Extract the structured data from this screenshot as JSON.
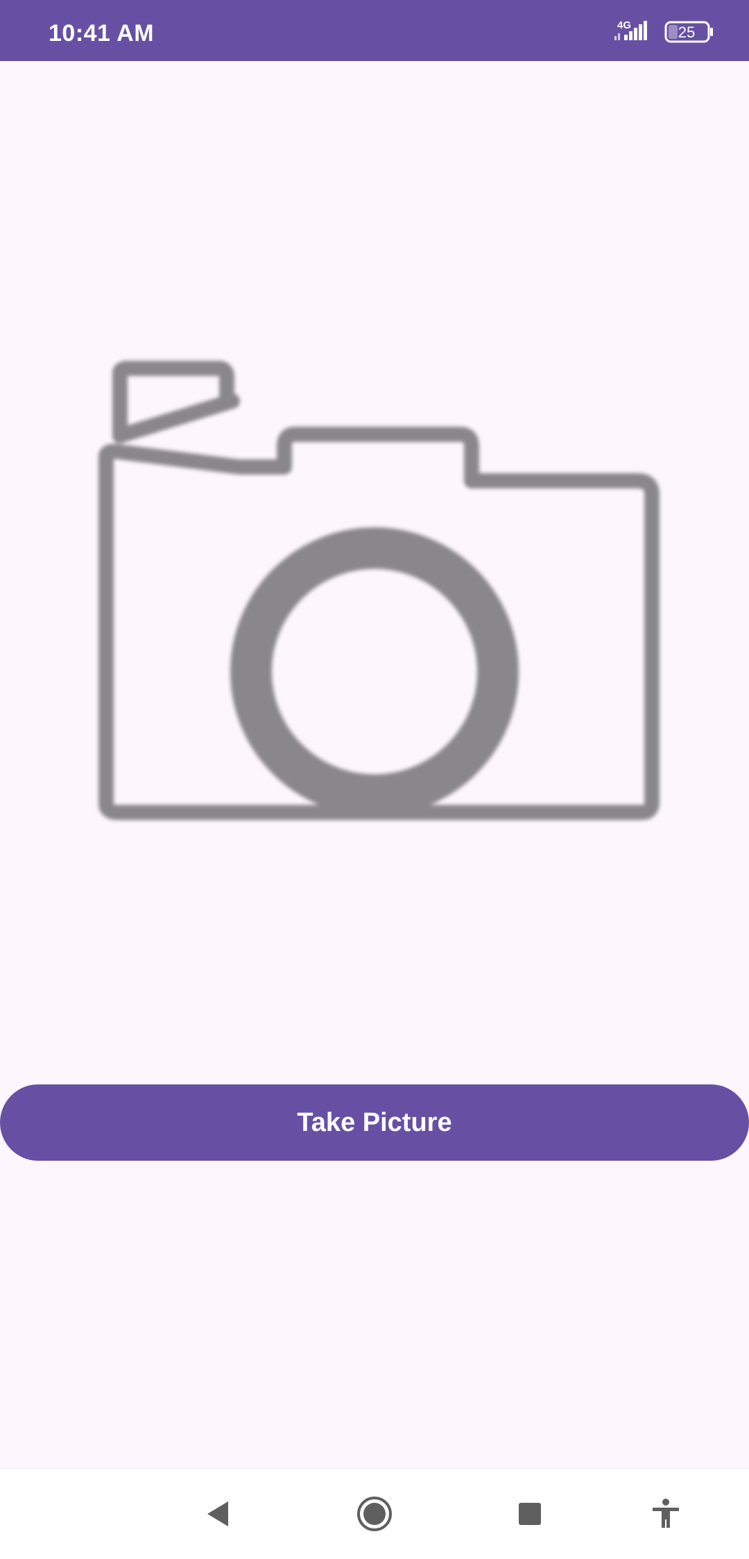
{
  "status_bar": {
    "time": "10:41 AM",
    "network_type": "4G",
    "battery_level": "25",
    "signal_icon": "signal-strength-icon",
    "battery_icon": "battery-icon"
  },
  "main": {
    "image_icon": "camera-placeholder-icon",
    "take_picture_label": "Take Picture"
  },
  "nav_bar": {
    "back_icon": "back-triangle-icon",
    "home_icon": "home-circle-icon",
    "recents_icon": "recents-square-icon",
    "accessibility_icon": "accessibility-icon"
  },
  "colors": {
    "primary": "#6750a4",
    "background": "#fdf7fd",
    "icon_gray": "#8a878c"
  }
}
